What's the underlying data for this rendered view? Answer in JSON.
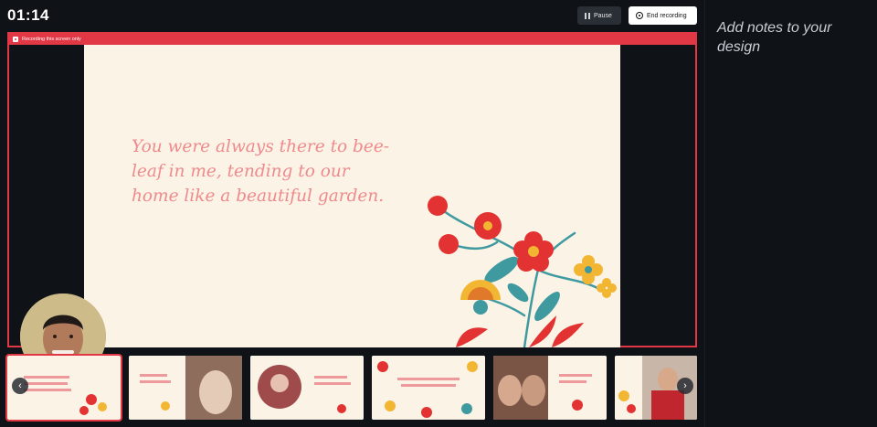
{
  "recording": {
    "timer": "01:14",
    "pause_label": "Pause",
    "end_label": "End recording",
    "banner_text": "Recording this screen only"
  },
  "slide": {
    "quote": "You were always there to bee-leaf in me, tending to our home like a beautiful garden."
  },
  "notes": {
    "placeholder": "Add notes to your design"
  },
  "thumbnails": {
    "count": 6,
    "selected_index": 0
  },
  "icons": [
    "pause-icon",
    "record-icon",
    "chevron-left-icon",
    "chevron-right-icon"
  ],
  "colors": {
    "recording_red": "#e23744",
    "background": "#0f1216",
    "slide_cream": "#fbf3e6",
    "quote_pink": "#ee8a8c"
  }
}
